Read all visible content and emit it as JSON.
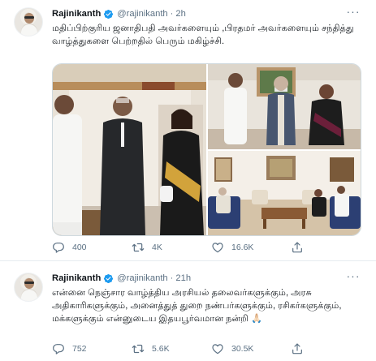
{
  "colors": {
    "text_primary": "#0f1419",
    "text_secondary": "#5b7083",
    "verified_blue": "#1d9bf0",
    "border": "#cfd9de"
  },
  "tweets": [
    {
      "author": {
        "name": "Rajinikanth",
        "handle": "@rajinikanth",
        "verified": true
      },
      "time": "2h",
      "text": "மதிப்பிற்குரிய ஜனாதிபதி அவர்களையும் ,பிரதமர் அவர்களையும் சந்தித்து வாழ்த்துகளை பெற்றதில் பெரும் மகிழ்ச்சி.",
      "media": {
        "photo_count": 3
      },
      "actions": {
        "reply": "400",
        "retweet": "4K",
        "like": "16.6K"
      }
    },
    {
      "author": {
        "name": "Rajinikanth",
        "handle": "@rajinikanth",
        "verified": true
      },
      "time": "21h",
      "text": "என்னை நெஞ்சார வாழ்த்திய அரசியல் தலைவர்களுக்கும், அரசு அதிகாரிகளுக்கும், அனைத்துத் துறை நண்பர்களுக்கும், ரசிகர்களுக்கும், மக்களுக்கும் என்னுடைய இதயபூர்வமான நன்றி 🙏🏻",
      "actions": {
        "reply": "752",
        "retweet": "5.6K",
        "like": "30.5K"
      }
    }
  ],
  "icons": {
    "more": "more-horizontal-icon",
    "verified": "verified-badge-icon",
    "reply": "reply-icon",
    "retweet": "retweet-icon",
    "like": "like-heart-icon",
    "share": "share-icon"
  }
}
